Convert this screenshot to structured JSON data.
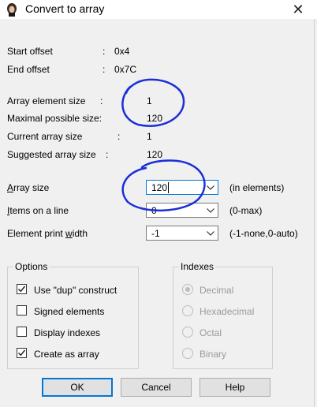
{
  "window": {
    "title": "Convert to array",
    "close_symbol": "✕"
  },
  "info": {
    "start_offset": {
      "label": "Start offset",
      "colon": ":",
      "value": "0x4"
    },
    "end_offset": {
      "label": "End offset",
      "colon": ":",
      "value": "0x7C"
    },
    "array_element_size": {
      "label": "Array element size",
      "colon": ":",
      "value": "1"
    },
    "maximal_possible_size": {
      "label": "Maximal possible size:",
      "value": "120"
    },
    "current_array_size": {
      "label": "Current array size",
      "colon": ":",
      "value": "1"
    },
    "suggested_array_size": {
      "label": "Suggested array size",
      "colon": ":",
      "value": "120"
    }
  },
  "fields": {
    "array_size": {
      "label_pre": "",
      "label_u": "A",
      "label_post": "rray size",
      "value": "120",
      "unit": "(in elements)"
    },
    "items_on_line": {
      "label_pre": "",
      "label_u": "I",
      "label_post": "tems on a line",
      "value": "0",
      "unit": "(0-max)"
    },
    "element_print_width": {
      "label_pre": "Element print ",
      "label_u": "w",
      "label_post": "idth",
      "value": "-1",
      "unit": "(-1-none,0-auto)"
    }
  },
  "options": {
    "title": "Options",
    "items": [
      {
        "label": "Use \"dup\" construct",
        "checked": true
      },
      {
        "label": "Signed elements",
        "checked": false
      },
      {
        "label": "Display indexes",
        "checked": false
      },
      {
        "label": "Create as array",
        "checked": true
      }
    ]
  },
  "indexes": {
    "title": "Indexes",
    "items": [
      {
        "label": "Decimal",
        "selected": true
      },
      {
        "label": "Hexadecimal",
        "selected": false
      },
      {
        "label": "Octal",
        "selected": false
      },
      {
        "label": "Binary",
        "selected": false
      }
    ]
  },
  "buttons": {
    "ok": "OK",
    "cancel": "Cancel",
    "help": "Help"
  },
  "colors": {
    "annotation_circle": "#1a2fd6",
    "focus_border": "#0078d7"
  }
}
